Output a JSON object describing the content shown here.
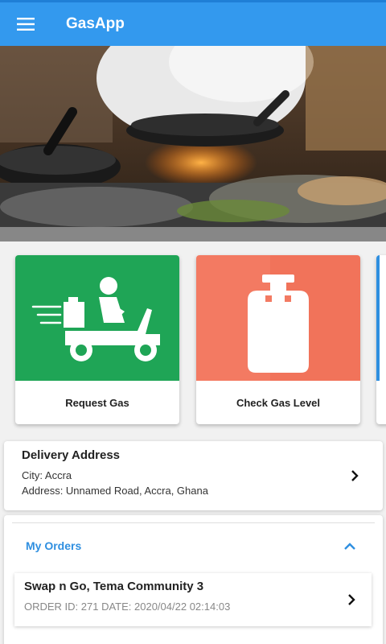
{
  "app_bar": {
    "title": "GasApp",
    "menu_icon": "hamburger-menu-icon"
  },
  "hero": {
    "image": "kitchen-frying-pans-photo"
  },
  "actions": [
    {
      "label": "Request Gas",
      "icon": "delivery-scooter-icon",
      "color": "#1fa556"
    },
    {
      "label": "Check Gas Level",
      "icon": "gas-cylinder-icon",
      "color": "#f37a62"
    }
  ],
  "delivery": {
    "title": "Delivery Address",
    "city": "City: Accra",
    "address": "Address: Unnamed Road, Accra, Ghana"
  },
  "orders": {
    "title": "My Orders",
    "items": [
      {
        "name": "Swap n Go, Tema Community 3",
        "meta": "ORDER ID: 271 DATE: 2020/04/22 02:14:03"
      }
    ]
  },
  "colors": {
    "accent": "#3399ee",
    "link": "#2f8fe0"
  }
}
